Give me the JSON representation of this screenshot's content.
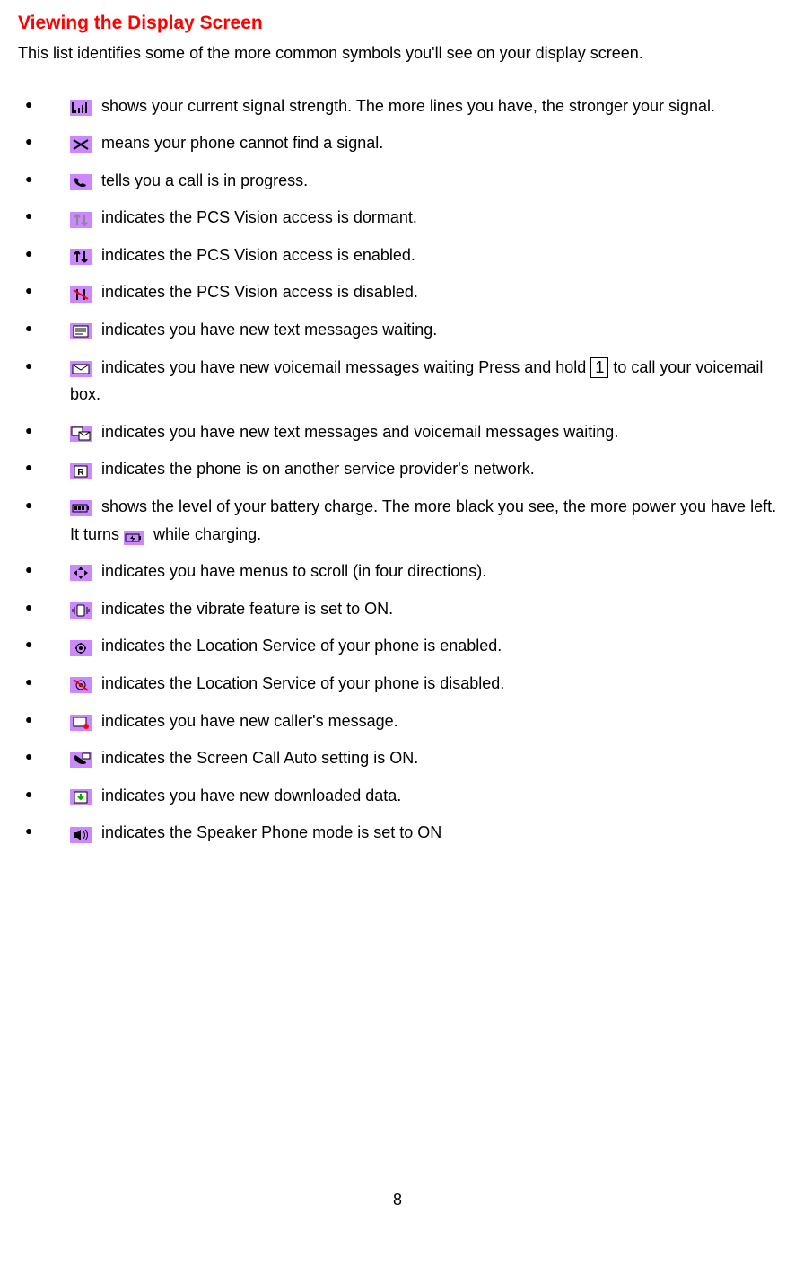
{
  "title": "Viewing the Display Screen",
  "intro": "This list identifies some of the more common symbols you'll see on your display screen.",
  "items": [
    {
      "icon": "signal-strength",
      "text": "shows your current signal strength. The more lines you have, the stronger your signal."
    },
    {
      "icon": "no-signal",
      "text": "means your phone cannot find a signal."
    },
    {
      "icon": "call-in-progress",
      "text": "tells you a call is in progress."
    },
    {
      "icon": "vision-dormant",
      "text": " indicates the PCS Vision access is dormant."
    },
    {
      "icon": "vision-enabled",
      "text": " indicates the PCS Vision access is enabled."
    },
    {
      "icon": "vision-disabled",
      "text": " indicates the PCS Vision access is disabled."
    },
    {
      "icon": "new-text",
      "text": "indicates you have new text messages waiting."
    },
    {
      "icon": "new-voicemail",
      "text_before": "indicates you have new voicemail messages waiting Press and hold ",
      "key": "1",
      "text_after": " to call your voicemail box."
    },
    {
      "icon": "new-text-voicemail",
      "text": "indicates you have new text messages and voicemail messages waiting."
    },
    {
      "icon": "roaming",
      "text": "indicates the phone is on another service provider's network."
    },
    {
      "icon": "battery",
      "text_before": "shows the level of your battery charge. The more black you see, the more power you have left. It turns ",
      "icon_inline": "battery-charging",
      "text_after": " while charging."
    },
    {
      "icon": "scroll-menus",
      "text": "indicates you have menus to scroll (in four directions)."
    },
    {
      "icon": "vibrate-on",
      "text": "indicates the vibrate feature is set to ON."
    },
    {
      "icon": "location-enabled",
      "text": " indicates the Location Service of your phone is enabled."
    },
    {
      "icon": "location-disabled",
      "text": " indicates the Location Service of your phone is disabled."
    },
    {
      "icon": "new-caller-message",
      "text": "indicates you have new caller's message."
    },
    {
      "icon": "screen-call-auto",
      "text": "indicates the Screen Call Auto setting is ON."
    },
    {
      "icon": "new-downloaded-data",
      "text": "indicates you have new downloaded data."
    },
    {
      "icon": "speaker-phone",
      "text": "indicates the Speaker Phone mode is set to ON"
    }
  ],
  "pageNumber": "8"
}
